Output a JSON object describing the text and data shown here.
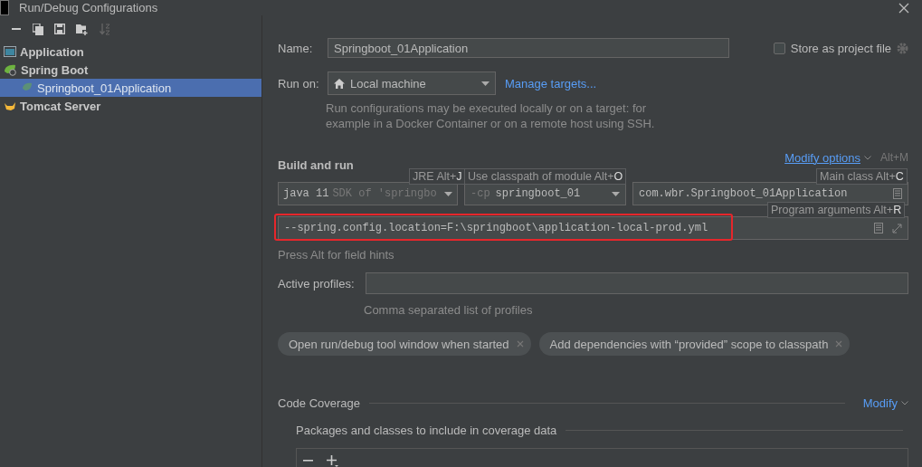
{
  "window": {
    "title": "Run/Debug Configurations"
  },
  "tree": [
    {
      "label": "Application",
      "kind": "application",
      "selected": false
    },
    {
      "label": "Spring Boot",
      "kind": "spring",
      "selected": false,
      "children": [
        {
          "label": "Springboot_01Application",
          "kind": "spring-config",
          "selected": true
        }
      ]
    },
    {
      "label": "Tomcat Server",
      "kind": "tomcat",
      "selected": false
    }
  ],
  "name": {
    "label": "Name:",
    "value": "Springboot_01Application"
  },
  "store": {
    "label": "Store as project file",
    "checked": false
  },
  "run_on": {
    "label": "Run on:",
    "value": "Local machine",
    "link": "Manage targets...",
    "hint": "Run configurations may be executed locally or on a target: for example in a Docker Container or on a remote host using SSH."
  },
  "build_and_run": {
    "title": "Build and run",
    "modify": "Modify options",
    "shortcut": "Alt+M",
    "jre": {
      "value": "java 11",
      "hint": "SDK of 'springbo"
    },
    "classpath": {
      "prefix": "-cp",
      "value": "springboot_01"
    },
    "main_class": "com.wbr.Springboot_01Application",
    "program_arguments": {
      "value": "--spring.config.location=F:\\springboot\\application-local-prod.yml",
      "highlighted": true
    },
    "field_hint": "Press Alt for field hints",
    "tooltips": [
      {
        "kind": "jre",
        "text": "JRE Alt+**J**"
      },
      {
        "kind": "classpath",
        "text": "Use classpath of module Alt+**O**"
      },
      {
        "kind": "main",
        "text": "Main class Alt+**C**"
      },
      {
        "kind": "args",
        "text": "Program arguments Alt+**R**"
      }
    ]
  },
  "active_profiles": {
    "label": "Active profiles:",
    "hint": "Comma separated list of profiles"
  },
  "options": [
    {
      "label": "Open run/debug tool window when started"
    },
    {
      "label": "Add dependencies with “provided” scope to classpath"
    }
  ],
  "code_coverage": {
    "title": "Code Coverage",
    "modify": "Modify",
    "packages": "Packages and classes to include in coverage data"
  }
}
